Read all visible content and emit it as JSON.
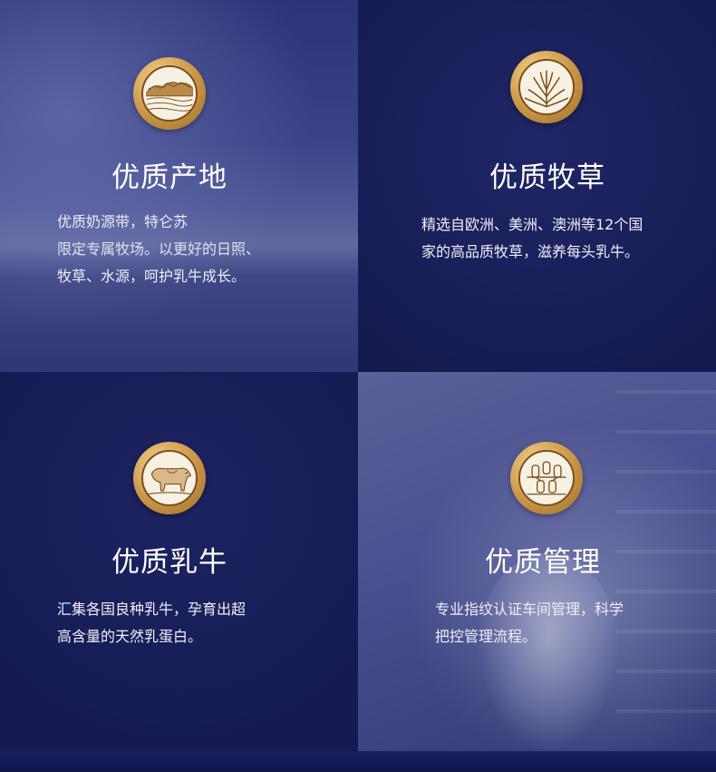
{
  "features": [
    {
      "title": "优质产地",
      "icon": "landscape-icon",
      "lines": [
        "优质奶源带，特仑苏",
        "限定专属牧场。以更好的日照、",
        "牧草、水源，呵护乳牛成长。"
      ]
    },
    {
      "title": "优质牧草",
      "icon": "grass-icon",
      "lines": [
        "精选自欧洲、美洲、澳洲等12个国",
        "家的高品质牧草，滋养每头乳牛。"
      ]
    },
    {
      "title": "优质乳牛",
      "icon": "cow-icon",
      "lines": [
        "汇集各国良种乳牛，孕育出超",
        "高含量的天然乳蛋白。"
      ]
    },
    {
      "title": "优质管理",
      "icon": "pipeline-icon",
      "lines": [
        "专业指纹认证车间管理，科学",
        "把控管理流程。"
      ]
    }
  ],
  "colors": {
    "gold": "#c89547",
    "emblem_inner": "#f7f1e3",
    "emblem_line": "#7a4f1a",
    "navy": "#141a4f"
  }
}
